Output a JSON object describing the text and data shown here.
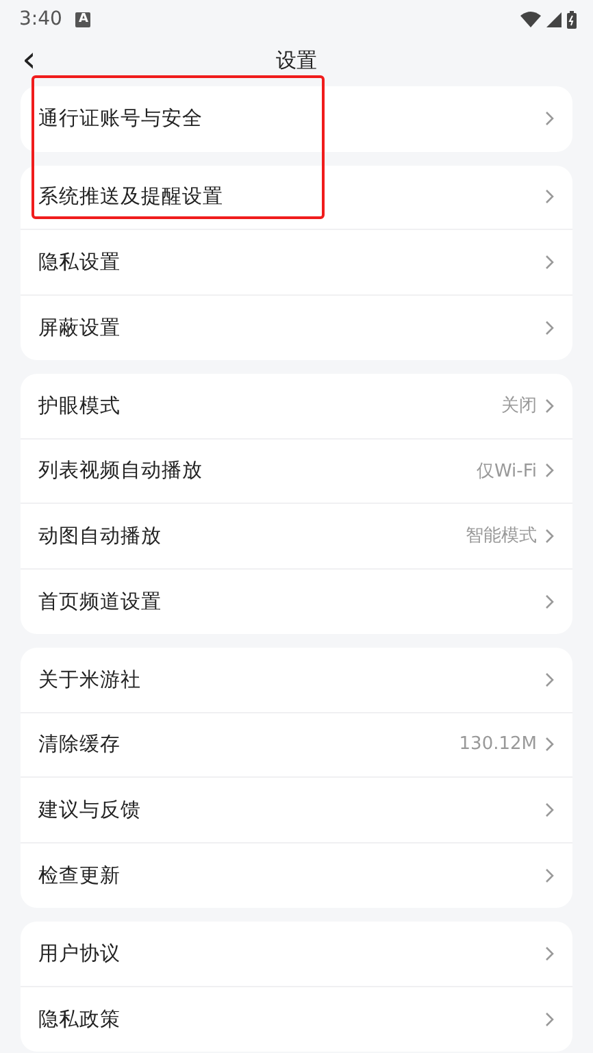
{
  "status_bar": {
    "time": "3:40",
    "notification_glyph": "A"
  },
  "header": {
    "back_glyph": "‹",
    "title": "设置"
  },
  "groups": [
    {
      "items": [
        {
          "label": "通行证账号与安全"
        }
      ]
    },
    {
      "items": [
        {
          "label": "系统推送及提醒设置"
        },
        {
          "label": "隐私设置"
        },
        {
          "label": "屏蔽设置"
        }
      ]
    },
    {
      "items": [
        {
          "label": "护眼模式",
          "value": "关闭"
        },
        {
          "label": "列表视频自动播放",
          "value": "仅Wi-Fi"
        },
        {
          "label": "动图自动播放",
          "value": "智能模式"
        },
        {
          "label": "首页频道设置"
        }
      ]
    },
    {
      "items": [
        {
          "label": "关于米游社"
        },
        {
          "label": "清除缓存",
          "value": "130.12M"
        },
        {
          "label": "建议与反馈"
        },
        {
          "label": "检查更新"
        }
      ]
    },
    {
      "items": [
        {
          "label": "用户协议"
        },
        {
          "label": "隐私政策"
        }
      ]
    }
  ],
  "annotation": {
    "kind": "rectangle"
  }
}
